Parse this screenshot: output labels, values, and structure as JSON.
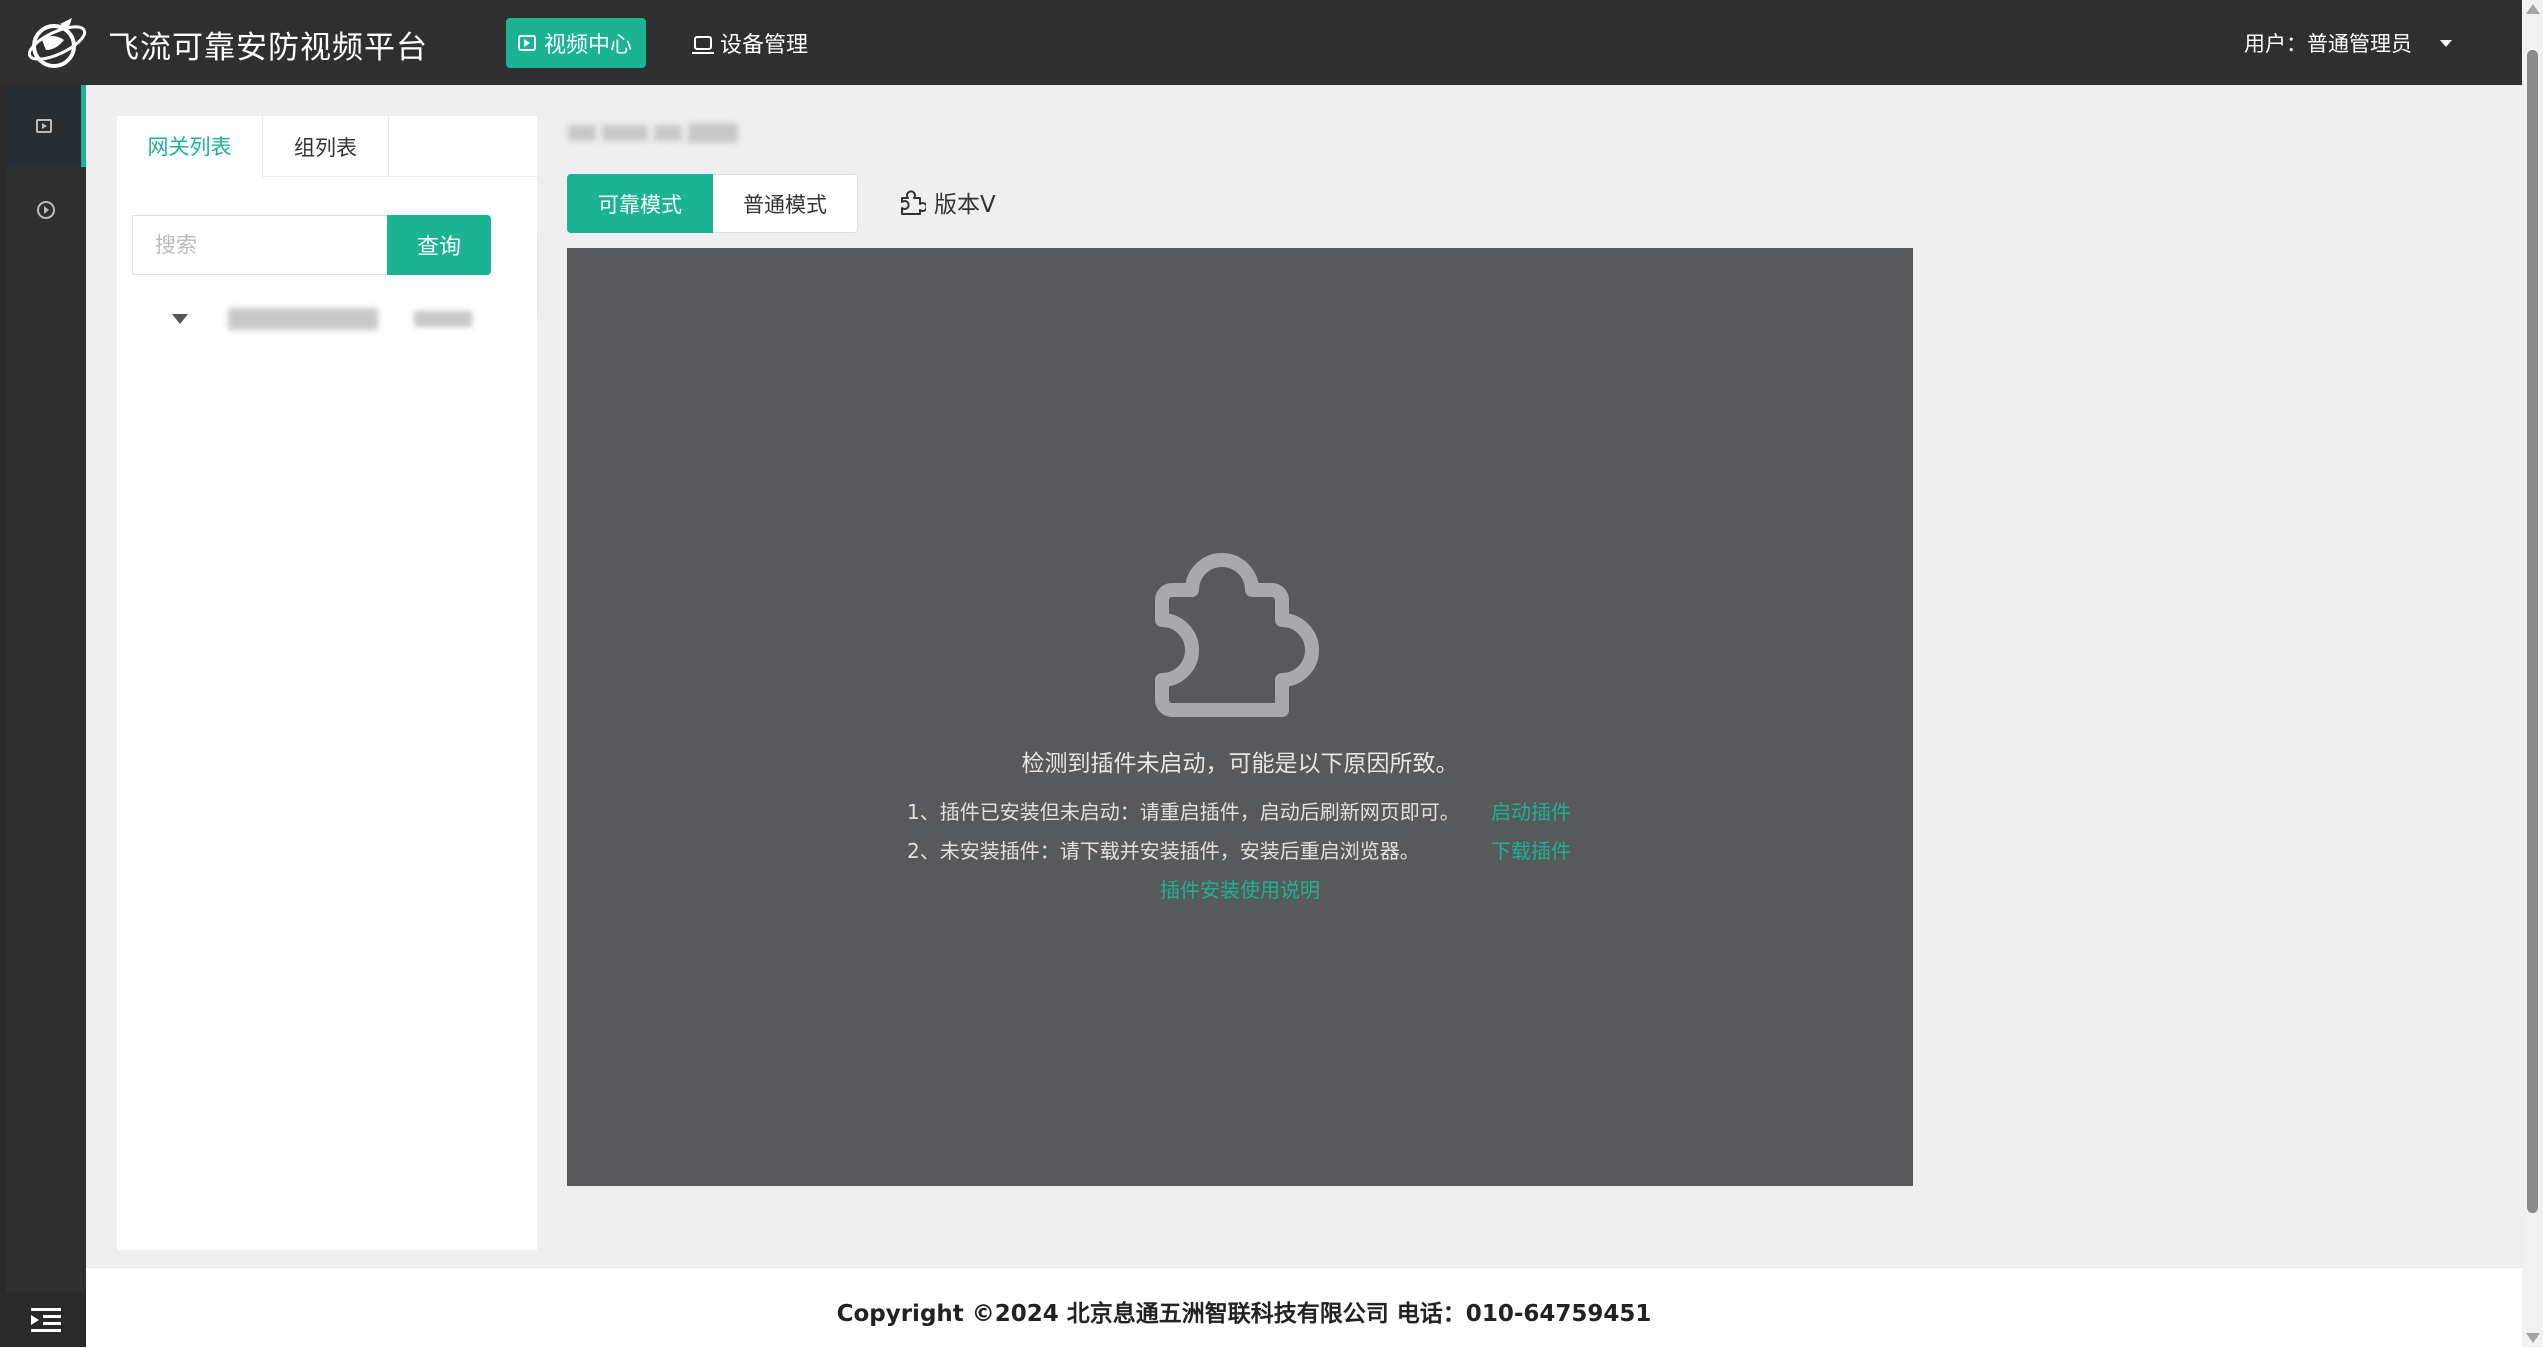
{
  "header": {
    "app_title": "飞流可靠安防视频平台",
    "nav": [
      {
        "label": "视频中心",
        "icon": "play-box-icon",
        "active": true
      },
      {
        "label": "设备管理",
        "icon": "monitor-icon",
        "active": false
      }
    ],
    "user_label": "用户：普通管理员"
  },
  "sidebar": {
    "items": [
      {
        "name": "video-center",
        "icon": "play-box-icon",
        "active": true
      },
      {
        "name": "playback",
        "icon": "replay-icon",
        "active": false
      }
    ],
    "collapse_icon": "indent-menu-icon"
  },
  "gateway_panel": {
    "tabs": [
      {
        "label": "网关列表",
        "active": true
      },
      {
        "label": "组列表",
        "active": false
      }
    ],
    "search_placeholder": "搜索",
    "query_label": "查询"
  },
  "main": {
    "modes": [
      {
        "label": "可靠模式",
        "active": true
      },
      {
        "label": "普通模式",
        "active": false
      }
    ],
    "version_label": "版本V"
  },
  "player": {
    "message": "检测到插件未启动，可能是以下原因所致。",
    "reason1": "1、插件已安装但未启动：请重启插件，启动后刷新网页即可。",
    "reason1_link": "启动插件",
    "reason2": "2、未安装插件：请下载并安装插件，安装后重启浏览器。",
    "reason2_link": "下载插件",
    "guide_link": "插件安装使用说明"
  },
  "footer": {
    "copyright": "Copyright ©2024 北京息通五洲智联科技有限公司 电话：010-64759451"
  },
  "colors": {
    "accent": "#1ab394",
    "header_bg": "#2f2f2f",
    "player_bg": "#58595b"
  }
}
